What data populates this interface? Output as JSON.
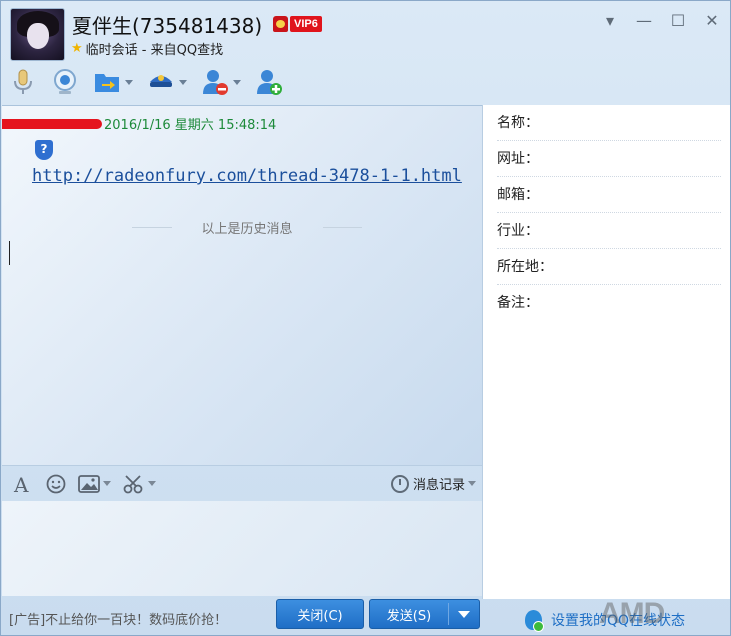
{
  "header": {
    "contact_name": "夏伴生(735481438)",
    "vip_label": "VIP6",
    "subtitle": "临时会话 - 来自QQ查找"
  },
  "window_controls": {
    "dropdown_icon": "▾",
    "minimize_icon": "—",
    "maximize_icon": "☐",
    "close_icon": "✕"
  },
  "toolbar": {
    "items": [
      {
        "name": "voice-call",
        "icon": "microphone-icon"
      },
      {
        "name": "video-call",
        "icon": "webcam-icon"
      },
      {
        "name": "send-file",
        "icon": "folder-arrow-icon"
      },
      {
        "name": "remote-assist",
        "icon": "police-cap-icon"
      },
      {
        "name": "block-user",
        "icon": "user-block-icon"
      },
      {
        "name": "add-friend",
        "icon": "user-add-icon"
      }
    ]
  },
  "chat": {
    "message_timestamp": "2016/1/16 星期六 15:48:14",
    "message_link": "http://radeonfury.com/thread-3478-1-1.html",
    "history_divider": "以上是历史消息"
  },
  "input_toolbar": {
    "history_button": "消息记录"
  },
  "bottom": {
    "ad_text": "[广告]不止给你一百块！数码底价抢！",
    "close_button": "关闭(C)",
    "send_button": "发送(S)",
    "online_status": "设置我的QQ在线状态"
  },
  "info_panel": {
    "rows": [
      {
        "label": "名称："
      },
      {
        "label": "网址："
      },
      {
        "label": "邮箱："
      },
      {
        "label": "行业："
      },
      {
        "label": "所在地："
      },
      {
        "label": "备注："
      }
    ]
  },
  "watermark": "AMD",
  "colors": {
    "accent": "#1f6ec6",
    "timestamp": "#1d8a3a",
    "link": "#1b4f9c",
    "vip": "#e0141c"
  }
}
